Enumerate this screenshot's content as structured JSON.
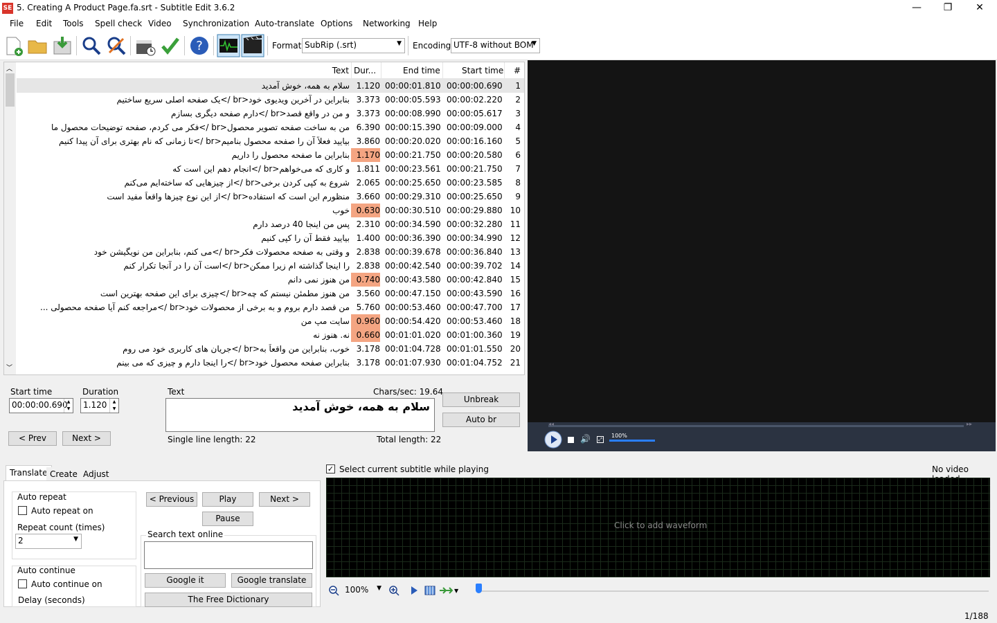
{
  "window": {
    "title": "5. Creating A Product Page.fa.srt - Subtitle Edit 3.6.2",
    "app_icon": "SE",
    "minimize": "—",
    "maximize": "❐",
    "close": "✕"
  },
  "menu": [
    "File",
    "Edit",
    "Tools",
    "Spell check",
    "Video",
    "Synchronization",
    "Auto-translate",
    "Options",
    "Networking",
    "Help"
  ],
  "toolbar": {
    "format_label": "Format",
    "format_value": "SubRip (.srt)",
    "encoding_label": "Encoding",
    "encoding_value": "UTF-8 without BOM"
  },
  "grid": {
    "headers": {
      "text": "Text",
      "dur": "Dur...",
      "end": "End time",
      "start": "Start time",
      "num": "#"
    },
    "rows": [
      {
        "n": "1",
        "start": "00:00:00.690",
        "end": "00:00:01.810",
        "dur": "1.120",
        "text": "سلام به همه، خوش آمدید",
        "warn": false
      },
      {
        "n": "2",
        "start": "00:00:02.220",
        "end": "00:00:05.593",
        "dur": "3.373",
        "text": "بنابراین در آخرین ویدیوی خود<br />یک صفحه اصلی سریع ساختیم",
        "warn": false
      },
      {
        "n": "3",
        "start": "00:00:05.617",
        "end": "00:00:08.990",
        "dur": "3.373",
        "text": "و من در واقع قصد<br />دارم صفحه دیگری بسازم",
        "warn": false
      },
      {
        "n": "4",
        "start": "00:00:09.000",
        "end": "00:00:15.390",
        "dur": "6.390",
        "text": "من به ساخت صفحه تصویر محصول<br />فکر می کردم، صفحه توضیحات محصول ما",
        "warn": false
      },
      {
        "n": "5",
        "start": "00:00:16.160",
        "end": "00:00:20.020",
        "dur": "3.860",
        "text": "بیایید فعلاً آن را صفحه محصول بنامیم<br />تا زمانی که نام بهتری برای آن پیدا کنیم",
        "warn": false
      },
      {
        "n": "6",
        "start": "00:00:20.580",
        "end": "00:00:21.750",
        "dur": "1.170",
        "text": "بنابراین ما صفحه محصول را داریم",
        "warn": true
      },
      {
        "n": "7",
        "start": "00:00:21.750",
        "end": "00:00:23.561",
        "dur": "1.811",
        "text": "و کاری که می‌خواهم<br />انجام دهم این است که",
        "warn": false
      },
      {
        "n": "8",
        "start": "00:00:23.585",
        "end": "00:00:25.650",
        "dur": "2.065",
        "text": "شروع به کپی کردن برخی<br />از چیزهایی که ساخته‌ایم می‌کنم",
        "warn": false
      },
      {
        "n": "9",
        "start": "00:00:25.650",
        "end": "00:00:29.310",
        "dur": "3.660",
        "text": "منظورم این است که استفاده<br />از این نوع چیزها واقعاً مفید است",
        "warn": false
      },
      {
        "n": "10",
        "start": "00:00:29.880",
        "end": "00:00:30.510",
        "dur": "0.630",
        "text": "خوب",
        "warn": true
      },
      {
        "n": "11",
        "start": "00:00:32.280",
        "end": "00:00:34.590",
        "dur": "2.310",
        "text": "پس من اینجا 40 درصد دارم",
        "warn": false
      },
      {
        "n": "12",
        "start": "00:00:34.990",
        "end": "00:00:36.390",
        "dur": "1.400",
        "text": "بیایید فقط آن را کپی کنیم",
        "warn": false
      },
      {
        "n": "13",
        "start": "00:00:36.840",
        "end": "00:00:39.678",
        "dur": "2.838",
        "text": "و وقتی به صفحه محصولات فکر<br />می کنم، بنابراین من نویگیشن خود",
        "warn": false
      },
      {
        "n": "14",
        "start": "00:00:39.702",
        "end": "00:00:42.540",
        "dur": "2.838",
        "text": "را اینجا گذاشته ام زیرا ممکن<br />است آن را در آنجا تکرار کنم",
        "warn": false
      },
      {
        "n": "15",
        "start": "00:00:42.840",
        "end": "00:00:43.580",
        "dur": "0.740",
        "text": "من هنوز نمی دانم",
        "warn": true
      },
      {
        "n": "16",
        "start": "00:00:43.590",
        "end": "00:00:47.150",
        "dur": "3.560",
        "text": "من هنوز مطمئن نیستم که چه<br />چیزی برای این صفحه بهترین است",
        "warn": false
      },
      {
        "n": "17",
        "start": "00:00:47.700",
        "end": "00:00:53.460",
        "dur": "5.760",
        "text": "من قصد دارم بروم و به برخی از محصولات خود<br />مراجعه کنم آیا صفحه محصولی ...",
        "warn": false
      },
      {
        "n": "18",
        "start": "00:00:53.460",
        "end": "00:00:54.420",
        "dur": "0.960",
        "text": "سایت مپ من",
        "warn": true
      },
      {
        "n": "19",
        "start": "00:01:00.360",
        "end": "00:01:01.020",
        "dur": "0.660",
        "text": "نه. هنوز نه",
        "warn": true
      },
      {
        "n": "20",
        "start": "00:01:01.550",
        "end": "00:01:04.728",
        "dur": "3.178",
        "text": "خوب، بنابراین من واقعاً به<br />جریان های کاربری خود می روم",
        "warn": false
      },
      {
        "n": "21",
        "start": "00:01:04.752",
        "end": "00:01:07.930",
        "dur": "3.178",
        "text": "بنابراین صفحه محصول خود<br />را اینجا دارم و چیزی که می بینم",
        "warn": false
      }
    ]
  },
  "edit": {
    "start_label": "Start time",
    "start_value": "00:00:00.690",
    "duration_label": "Duration",
    "duration_value": "1.120",
    "text_label": "Text",
    "chars_sec": "Chars/sec: 19.64",
    "text_value": "سلام به همه، خوش آمدید",
    "single_line": "Single line length: 22",
    "total_length": "Total length: 22",
    "prev": "< Prev",
    "next": "Next >",
    "unbreak": "Unbreak",
    "auto_br": "Auto br"
  },
  "video": {
    "volume": "100%"
  },
  "bottom": {
    "tabs": [
      "Translate",
      "Create",
      "Adjust"
    ],
    "auto_repeat": "Auto repeat",
    "auto_repeat_on": "Auto repeat on",
    "repeat_count_label": "Repeat count (times)",
    "repeat_count_value": "2",
    "auto_continue": "Auto continue",
    "auto_continue_on": "Auto continue on",
    "delay_label": "Delay (seconds)",
    "previous": "< Previous",
    "play": "Play",
    "next": "Next >",
    "pause": "Pause",
    "search_label": "Search text online",
    "google_it": "Google it",
    "google_translate": "Google translate",
    "free_dictionary": "The Free Dictionary",
    "select_current": "Select current subtitle while playing",
    "no_video": "No video loaded",
    "waveform_hint": "Click to add waveform",
    "zoom": "100%"
  },
  "status": {
    "position": "1/188"
  }
}
